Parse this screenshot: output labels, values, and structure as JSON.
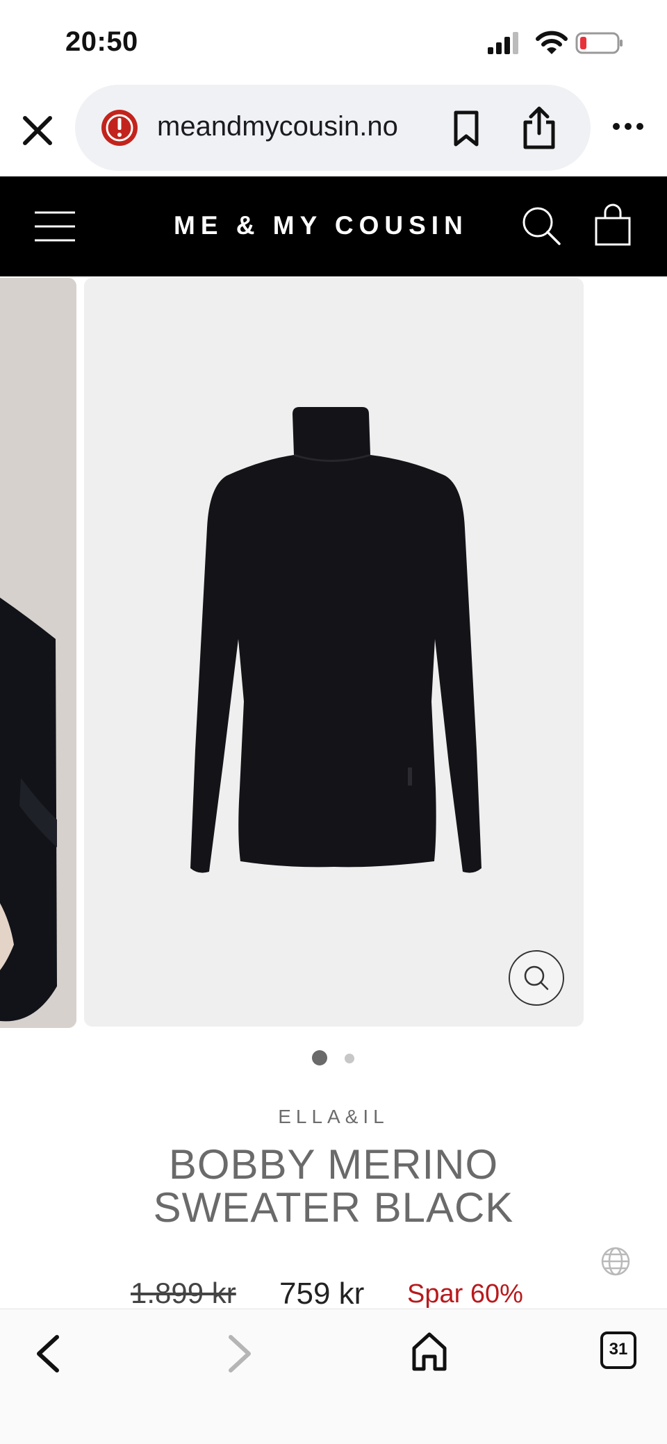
{
  "status_bar": {
    "time": "20:50"
  },
  "browser": {
    "url": "meandmycousin.no",
    "tab_count": "31"
  },
  "site": {
    "logo": "ME & MY COUSIN"
  },
  "gallery": {
    "slide_count": 2,
    "active_slide": 1
  },
  "product": {
    "brand": "ELLA&IL",
    "title_line1": "BOBBY MERINO",
    "title_line2": "SWEATER BLACK",
    "old_price": "1.899 kr",
    "price": "759 kr",
    "discount": "Spar 60%"
  },
  "colors": {
    "header_bg": "#000000",
    "discount": "#b8191c",
    "title": "#6a6a6a",
    "url_pill": "#f0f1f4"
  }
}
